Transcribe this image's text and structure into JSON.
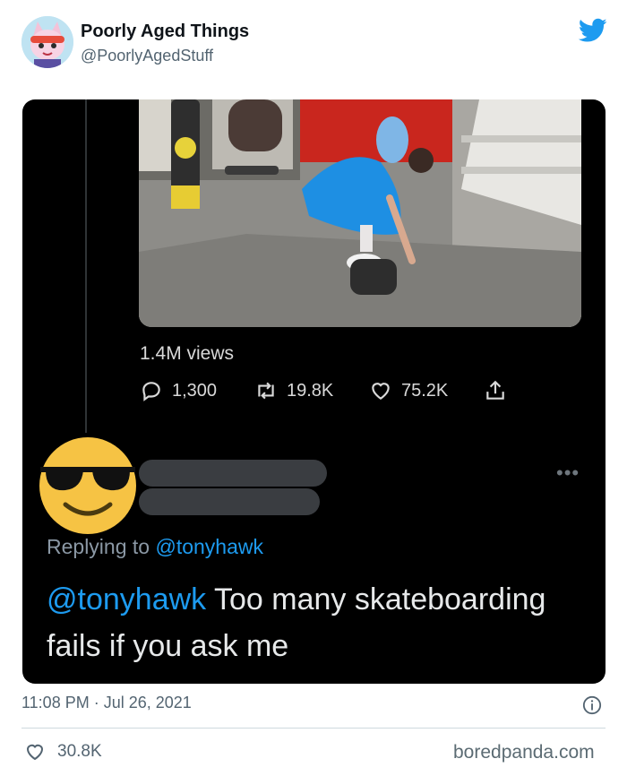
{
  "tweet": {
    "display_name": "Poorly Aged Things",
    "handle": "@PoorlyAgedStuff",
    "timestamp": "11:08 PM · Jul 26, 2021",
    "likes": "30.8K"
  },
  "embedded": {
    "views": "1.4M views",
    "replies": "1,300",
    "retweets": "19.8K",
    "likes": "75.2K",
    "more_label": "•••",
    "replying_prefix": "Replying to",
    "replying_to": "@tonyhawk",
    "reply_mention": "@tonyhawk",
    "reply_body": " Too many skateboarding fails if you ask me"
  },
  "watermark": "boredpanda.com",
  "colors": {
    "twitter_blue": "#1d9bf0",
    "dark_bg": "#000000",
    "muted": "#536471"
  },
  "icons": [
    "avatar-cat-icon",
    "twitter-bird-icon",
    "reply-icon",
    "retweet-icon",
    "heart-icon",
    "share-icon",
    "sunglasses-emoji-icon",
    "info-icon"
  ]
}
